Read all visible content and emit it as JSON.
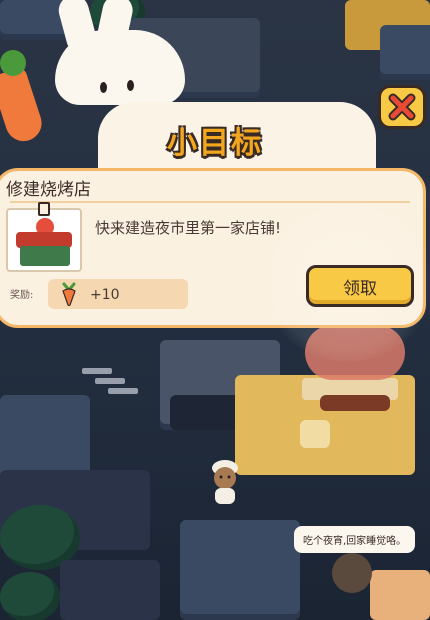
{
  "panel": {
    "title": "小目标",
    "task_name": "修建烧烤店",
    "description": "快来建造夜市里第一家店铺!",
    "reward_label": "奖励:",
    "reward_amount": "+10",
    "reward_icon": "carrot-icon",
    "claim_label": "领取",
    "close_icon": "close-x-icon"
  },
  "scene": {
    "speech_text": "吃个夜宵,回家睡觉咯。"
  },
  "colors": {
    "accent_yellow": "#f7c944",
    "title_orange": "#f2a71f",
    "panel_bg": "#fbf1e1",
    "panel_border": "#f4b768",
    "night_bg": "#243042"
  }
}
